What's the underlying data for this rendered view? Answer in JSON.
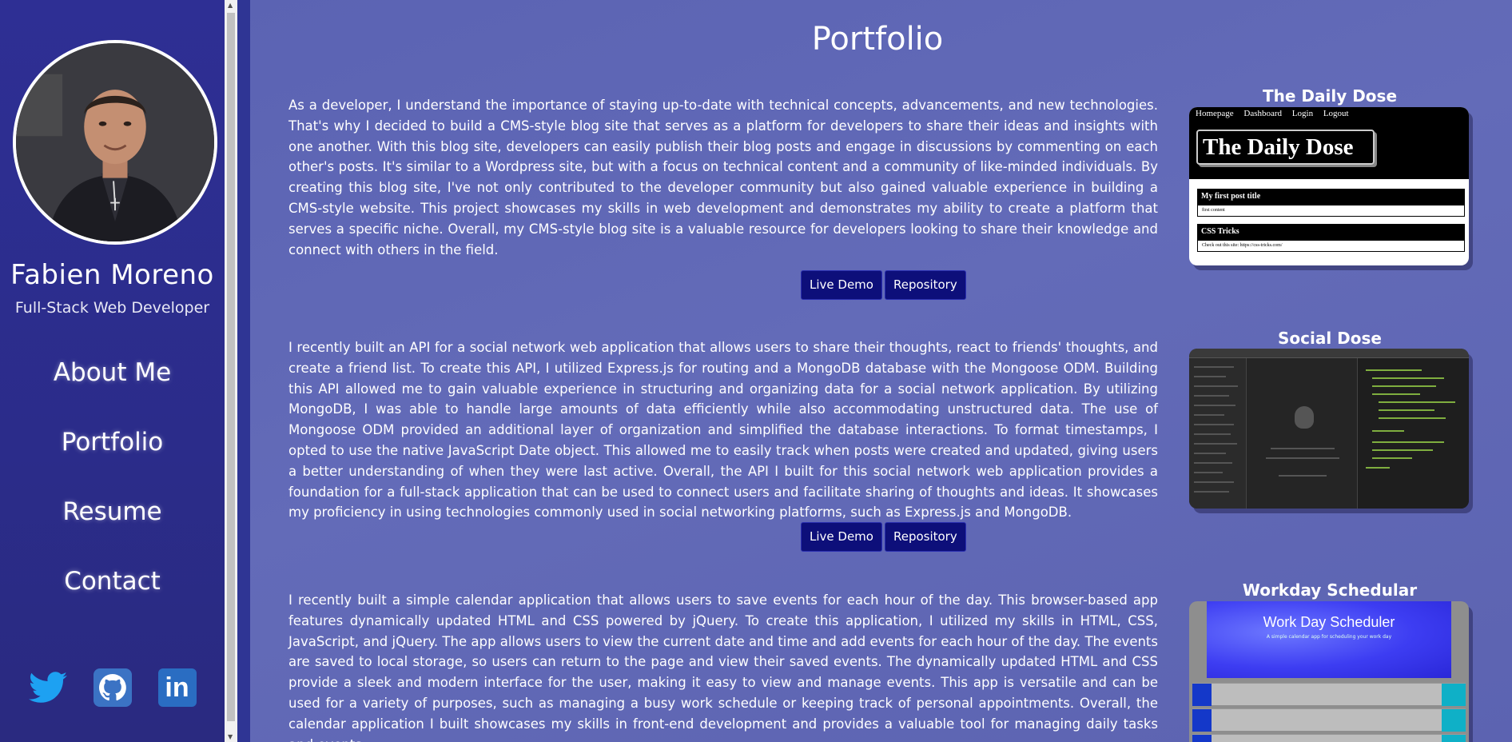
{
  "sidebar": {
    "name": "Fabien Moreno",
    "role": "Full-Stack Web Developer",
    "nav": [
      "About Me",
      "Portfolio",
      "Resume",
      "Contact"
    ],
    "social": [
      "twitter-icon",
      "github-icon",
      "linkedin-icon"
    ]
  },
  "main": {
    "title": "Portfolio",
    "projects": [
      {
        "title": "The Daily Dose",
        "description": "As a developer, I understand the importance of staying up-to-date with technical concepts, advancements, and new technologies. That's why I decided to build a CMS-style blog site that serves as a platform for developers to share their ideas and insights with one another. With this blog site, developers can easily publish their blog posts and engage in discussions by commenting on each other's posts. It's similar to a Wordpress site, but with a focus on technical content and a community of like-minded individuals. By creating this blog site, I've not only contributed to the developer community but also gained valuable experience in building a CMS-style website. This project showcases my skills in web development and demonstrates my ability to create a platform that serves a specific niche. Overall, my CMS-style blog site is a valuable resource for developers looking to share their knowledge and connect with others in the field.",
        "demo_label": "Live Demo",
        "repo_label": "Repository",
        "preview": {
          "nav": "Homepage Dashboard Login Logout",
          "logo": "The Daily Dose",
          "post1_title": "My first post title",
          "post1_body": "first content",
          "post2_title": "CSS Tricks",
          "post2_body": "Check out this site: https://css-tricks.com/"
        }
      },
      {
        "title": "Social Dose",
        "description": "I recently built an API for a social network web application that allows users to share their thoughts, react to friends' thoughts, and create a friend list. To create this API, I utilized Express.js for routing and a MongoDB database with the Mongoose ODM. Building this API allowed me to gain valuable experience in structuring and organizing data for a social network application. By utilizing MongoDB, I was able to handle large amounts of data efficiently while also accommodating unstructured data. The use of Mongoose ODM provided an additional layer of organization and simplified the database interactions. To format timestamps, I opted to use the native JavaScript Date object. This allowed me to easily track when posts were created and updated, giving users a better understanding of when they were last active. Overall, the API I built for this social network web application provides a foundation for a full-stack application that can be used to connect users and facilitate sharing of thoughts and ideas. It showcases my proficiency in using technologies commonly used in social networking platforms, such as Express.js and MongoDB.",
        "demo_label": "Live Demo",
        "repo_label": "Repository"
      },
      {
        "title": "Workday Schedular",
        "description": "I recently built a simple calendar application that allows users to save events for each hour of the day. This browser-based app features dynamically updated HTML and CSS powered by jQuery. To create this application, I utilized my skills in HTML, CSS, JavaScript, and jQuery. The app allows users to view the current date and time and add events for each hour of the day. The events are saved to local storage, so users can return to the page and view their saved events. The dynamically updated HTML and CSS provide a sleek and modern interface for the user, making it easy to view and manage events. This app is versatile and can be used for a variety of purposes, such as managing a busy work schedule or keeping track of personal appointments. Overall, the calendar application I built showcases my skills in front-end development and provides a valuable tool for managing daily tasks and events.",
        "preview": {
          "title": "Work Day Scheduler",
          "subtitle": "A simple calendar app for scheduling your work day"
        }
      }
    ]
  }
}
